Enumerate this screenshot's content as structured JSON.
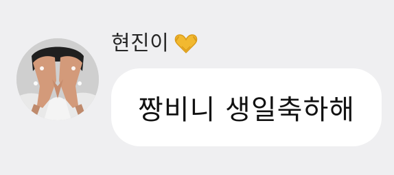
{
  "message": {
    "sender_name": "현진이",
    "sender_emoji": "heart-hands-icon",
    "text": "짱비니 생일축하해"
  },
  "colors": {
    "background": "#efeff1",
    "bubble": "#ffffff",
    "text": "#111111",
    "emoji": "#f2b930"
  }
}
